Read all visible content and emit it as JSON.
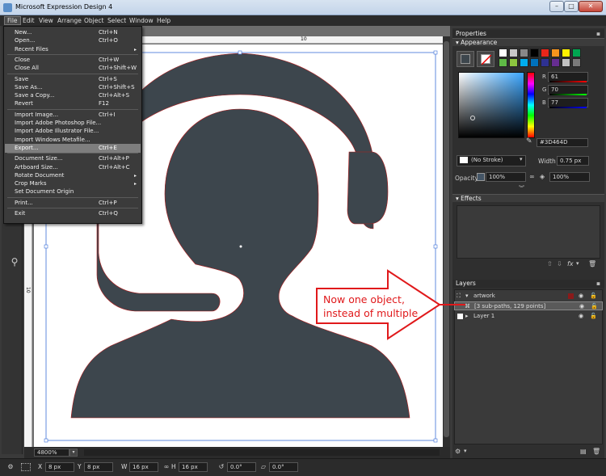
{
  "window": {
    "title": "Microsoft Expression Design 4"
  },
  "menubar": {
    "items": [
      "File",
      "Edit",
      "View",
      "Arrange",
      "Object",
      "Select",
      "Window",
      "Help"
    ]
  },
  "file_menu": {
    "items": [
      {
        "label": "New...",
        "shortcut": "Ctrl+N"
      },
      {
        "label": "Open...",
        "shortcut": "Ctrl+O"
      },
      {
        "label": "Recent Files",
        "shortcut": "",
        "submenu": true
      },
      {
        "label": "Close",
        "shortcut": "Ctrl+W"
      },
      {
        "label": "Close All",
        "shortcut": "Ctrl+Shift+W"
      },
      {
        "label": "Save",
        "shortcut": "Ctrl+S"
      },
      {
        "label": "Save As...",
        "shortcut": "Ctrl+Shift+S"
      },
      {
        "label": "Save a Copy...",
        "shortcut": "Ctrl+Alt+S"
      },
      {
        "label": "Revert",
        "shortcut": "F12"
      },
      {
        "label": "Import Image...",
        "shortcut": "Ctrl+I"
      },
      {
        "label": "Import Adobe Photoshop File...",
        "shortcut": ""
      },
      {
        "label": "Import Adobe Illustrator File...",
        "shortcut": ""
      },
      {
        "label": "Import Windows Metafile...",
        "shortcut": ""
      },
      {
        "label": "Export...",
        "shortcut": "Ctrl+E",
        "highlighted": true
      },
      {
        "label": "Document Size...",
        "shortcut": "Ctrl+Alt+P"
      },
      {
        "label": "Artboard Size...",
        "shortcut": "Ctrl+Alt+C"
      },
      {
        "label": "Rotate Document",
        "shortcut": "",
        "submenu": true
      },
      {
        "label": "Crop Marks",
        "shortcut": "",
        "submenu": true
      },
      {
        "label": "Set Document Origin",
        "shortcut": ""
      },
      {
        "label": "Print...",
        "shortcut": "Ctrl+P"
      },
      {
        "label": "Exit",
        "shortcut": "Ctrl+Q"
      }
    ]
  },
  "canvas": {
    "ruler_top_label": "10",
    "ruler_left_label": "10",
    "zoom": "4800%",
    "artwork_color": "#3D464D"
  },
  "status": {
    "x_label": "X",
    "x_value": "8 px",
    "y_label": "Y",
    "y_value": "8 px",
    "w_label": "W",
    "w_value": "16 px",
    "h_label": "H",
    "h_value": "16 px",
    "rotation": "0.0°",
    "skew": "0.0°"
  },
  "properties": {
    "title": "Properties",
    "appearance_label": "Appearance",
    "r_label": "R",
    "r_value": "61",
    "g_label": "G",
    "g_value": "70",
    "b_label": "B",
    "b_value": "77",
    "hex": "#3D464D",
    "stroke_label": "(No Stroke)",
    "width_label": "Width",
    "width_value": "0.75 px",
    "opacity_label": "Opacity",
    "opacity_value": "100%",
    "fill_opacity_value": "100%",
    "swatches": [
      "#ffffff",
      "#c9c9c9",
      "#888888",
      "#000000",
      "#e8261a",
      "#f7941d",
      "#fff200",
      "#00a651",
      "#5fba46",
      "#8dc63f",
      "#00aeef",
      "#0072bc",
      "#2e3192",
      "#662d91",
      "#c2c2c2",
      "#7a7a7a"
    ]
  },
  "effects": {
    "title": "Effects"
  },
  "layers": {
    "title": "Layers",
    "rows": [
      {
        "name": "artwork",
        "color": "#8b1a1a"
      },
      {
        "name": "[3 sub-paths, 129 points]",
        "selected": true
      },
      {
        "name": "Layer 1",
        "color": "#3a3a3a"
      }
    ]
  },
  "annotation": {
    "line1": "Now one object,",
    "line2": "instead of multiple",
    "color": "#e0191b"
  }
}
